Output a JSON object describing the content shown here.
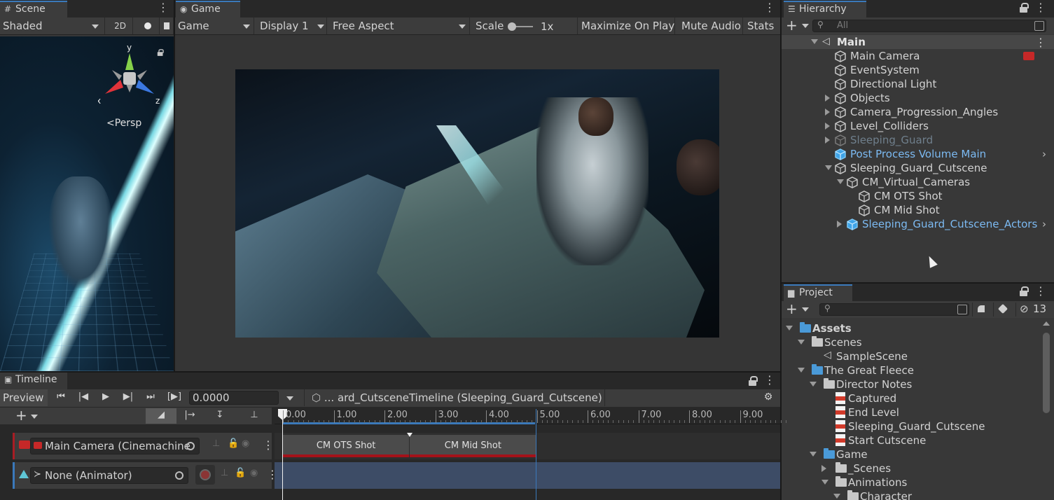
{
  "scene": {
    "tab_label": "Scene",
    "shading_mode": "Shaded",
    "mode_2d": "2D",
    "gizmo_axes": {
      "y": "y",
      "x": "x",
      "z": "z"
    },
    "projection_label": "Persp"
  },
  "game": {
    "tab_label": "Game",
    "view_mode": "Game",
    "display": "Display 1",
    "aspect": "Free Aspect",
    "scale_label": "Scale",
    "scale_value": "1x",
    "maximize_on_play": "Maximize On Play",
    "mute_audio": "Mute Audio",
    "stats": "Stats"
  },
  "hierarchy": {
    "tab_label": "Hierarchy",
    "search_placeholder": "All",
    "scene_name": "Main",
    "items": [
      {
        "label": "Main Camera",
        "depth": 0,
        "expander": "none",
        "style": "normal"
      },
      {
        "label": "EventSystem",
        "depth": 0,
        "expander": "none",
        "style": "normal"
      },
      {
        "label": "Directional Light",
        "depth": 0,
        "expander": "none",
        "style": "normal"
      },
      {
        "label": "Objects",
        "depth": 0,
        "expander": "collapsed",
        "style": "normal"
      },
      {
        "label": "Camera_Progression_Angles",
        "depth": 0,
        "expander": "collapsed",
        "style": "normal"
      },
      {
        "label": "Level_Colliders",
        "depth": 0,
        "expander": "collapsed",
        "style": "normal"
      },
      {
        "label": "Sleeping_Guard",
        "depth": 0,
        "expander": "collapsed",
        "style": "disabled-prefab"
      },
      {
        "label": "Post Process Volume Main",
        "depth": 0,
        "expander": "none",
        "style": "prefab"
      },
      {
        "label": "Sleeping_Guard_Cutscene",
        "depth": 0,
        "expander": "expanded",
        "style": "normal"
      },
      {
        "label": "CM_Virtual_Cameras",
        "depth": 1,
        "expander": "expanded",
        "style": "normal"
      },
      {
        "label": "CM OTS Shot",
        "depth": 2,
        "expander": "none",
        "style": "normal"
      },
      {
        "label": "CM Mid Shot",
        "depth": 2,
        "expander": "none",
        "style": "normal"
      },
      {
        "label": "Sleeping_Guard_Cutscene_Actors",
        "depth": 1,
        "expander": "collapsed",
        "style": "prefab"
      }
    ]
  },
  "project": {
    "tab_label": "Project",
    "hidden_count": "13",
    "items": [
      {
        "label": "Assets",
        "depth": 0,
        "icon": "folder-blue",
        "expander": "expanded",
        "bold": true
      },
      {
        "label": "Scenes",
        "depth": 1,
        "icon": "folder-open",
        "expander": "expanded",
        "bold": false
      },
      {
        "label": "SampleScene",
        "depth": 2,
        "icon": "unity",
        "expander": "none",
        "bold": false
      },
      {
        "label": "The Great Fleece",
        "depth": 1,
        "icon": "folder-blue",
        "expander": "expanded",
        "bold": false
      },
      {
        "label": "Director Notes",
        "depth": 2,
        "icon": "folder-open",
        "expander": "expanded",
        "bold": false
      },
      {
        "label": "Captured",
        "depth": 3,
        "icon": "pdf",
        "expander": "none",
        "bold": false
      },
      {
        "label": "End Level",
        "depth": 3,
        "icon": "pdf",
        "expander": "none",
        "bold": false
      },
      {
        "label": "Sleeping_Guard_Cutscene",
        "depth": 3,
        "icon": "pdf",
        "expander": "none",
        "bold": false
      },
      {
        "label": "Start Cutscene",
        "depth": 3,
        "icon": "pdf",
        "expander": "none",
        "bold": false
      },
      {
        "label": "Game",
        "depth": 2,
        "icon": "folder-blue",
        "expander": "expanded",
        "bold": false
      },
      {
        "label": "_Scenes",
        "depth": 3,
        "icon": "folder",
        "expander": "collapsed",
        "bold": false
      },
      {
        "label": "Animations",
        "depth": 3,
        "icon": "folder-open",
        "expander": "expanded",
        "bold": false
      },
      {
        "label": "Character",
        "depth": 4,
        "icon": "folder-open",
        "expander": "expanded",
        "bold": false
      }
    ]
  },
  "timeline": {
    "tab_label": "Timeline",
    "preview_label": "Preview",
    "time_value": "0.0000",
    "asset_label": "... ard_CutsceneTimeline (Sleeping_Guard_Cutscene)",
    "ruler_labels": [
      "0.00",
      "1.00",
      "2.00",
      "3.00",
      "4.00",
      "5.00",
      "6.00",
      "7.00",
      "8.00",
      "9.00"
    ],
    "tracks": [
      {
        "binding": "Main Camera (Cinemachine",
        "type": "cinemachine"
      },
      {
        "binding": "None (Animator)",
        "type": "animation"
      }
    ],
    "clips": [
      {
        "label": "CM OTS Shot",
        "start": 0.0,
        "end": 2.5
      },
      {
        "label": "CM Mid Shot",
        "start": 2.5,
        "end": 5.0
      }
    ]
  }
}
